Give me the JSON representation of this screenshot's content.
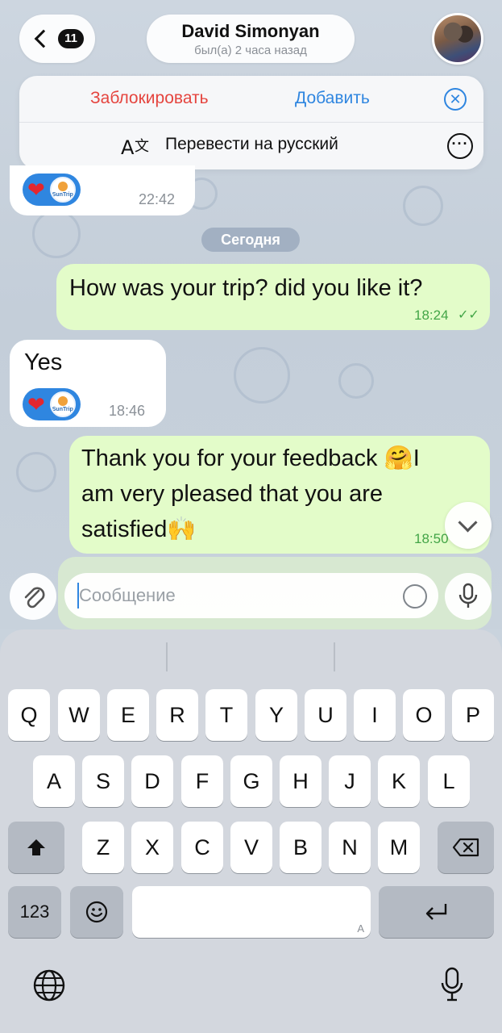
{
  "header": {
    "back_count": "11",
    "contact_name": "David Simonyan",
    "status": "был(а) 2 часа назад"
  },
  "action_panel": {
    "block_label": "Заблокировать",
    "add_label": "Добавить",
    "translate_label": "Перевести на русский"
  },
  "messages": [
    {
      "direction": "incoming",
      "reaction": "❤",
      "reactor_label": "SunTrip",
      "time": "22:42"
    },
    {
      "direction": "outgoing",
      "text": "How was your trip? did you like it?",
      "time": "18:24"
    },
    {
      "direction": "incoming",
      "text": "Yes",
      "reaction": "❤",
      "reactor_label": "SunTrip",
      "time": "18:46"
    },
    {
      "direction": "outgoing",
      "text_lines": [
        "Thank you for your feedback 🤗I",
        "am very pleased that you are",
        "satisfied🙌"
      ],
      "time": "18:50"
    }
  ],
  "date_separator": "Сегодня",
  "composer": {
    "placeholder": "Сообщение"
  },
  "keyboard": {
    "row1": [
      "Q",
      "W",
      "E",
      "R",
      "T",
      "Y",
      "U",
      "I",
      "O",
      "P"
    ],
    "row2": [
      "A",
      "S",
      "D",
      "F",
      "G",
      "H",
      "J",
      "K",
      "L"
    ],
    "row3": [
      "Z",
      "X",
      "C",
      "V",
      "B",
      "N",
      "M"
    ],
    "numbers_label": "123",
    "space_hint": "A"
  },
  "colors": {
    "accent": "#2f86e0",
    "destructive": "#e5453f",
    "outgoing_bubble": "#e3fcc9",
    "time_green": "#43a547"
  }
}
